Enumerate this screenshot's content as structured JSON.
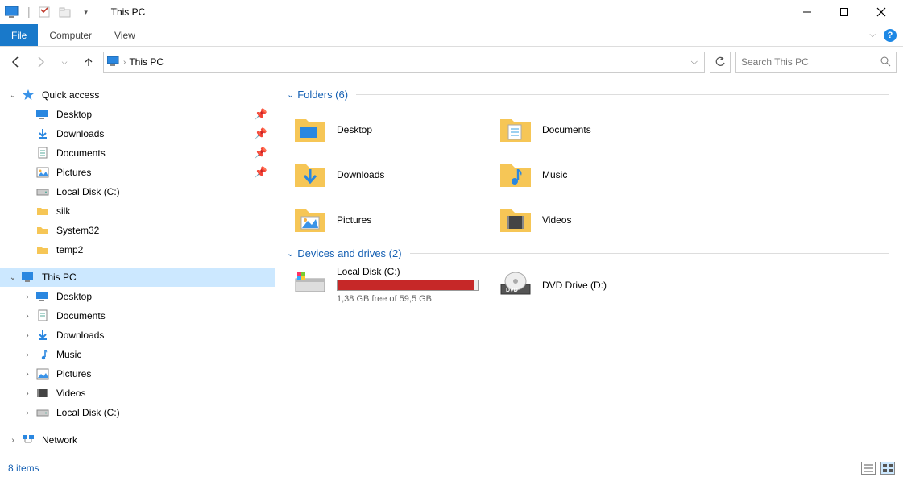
{
  "titlebar": {
    "title": "This PC"
  },
  "ribbon": {
    "file": "File",
    "tabs": [
      "Computer",
      "View"
    ]
  },
  "address": {
    "path": "This PC"
  },
  "search": {
    "placeholder": "Search This PC"
  },
  "sidebar": {
    "quick_access": {
      "label": "Quick access",
      "items": [
        {
          "label": "Desktop",
          "icon": "desktop",
          "pinned": true
        },
        {
          "label": "Downloads",
          "icon": "downloads",
          "pinned": true
        },
        {
          "label": "Documents",
          "icon": "documents",
          "pinned": true
        },
        {
          "label": "Pictures",
          "icon": "pictures",
          "pinned": true
        },
        {
          "label": "Local Disk (C:)",
          "icon": "disk",
          "pinned": false
        },
        {
          "label": "silk",
          "icon": "folder",
          "pinned": false
        },
        {
          "label": "System32",
          "icon": "folder",
          "pinned": false
        },
        {
          "label": "temp2",
          "icon": "folder",
          "pinned": false
        }
      ]
    },
    "this_pc": {
      "label": "This PC",
      "items": [
        {
          "label": "Desktop",
          "icon": "desktop"
        },
        {
          "label": "Documents",
          "icon": "documents"
        },
        {
          "label": "Downloads",
          "icon": "downloads"
        },
        {
          "label": "Music",
          "icon": "music"
        },
        {
          "label": "Pictures",
          "icon": "pictures"
        },
        {
          "label": "Videos",
          "icon": "videos"
        },
        {
          "label": "Local Disk (C:)",
          "icon": "disk"
        }
      ]
    },
    "network": {
      "label": "Network"
    }
  },
  "content": {
    "folders_head": "Folders (6)",
    "folders": [
      {
        "label": "Desktop",
        "icon": "desktop-big"
      },
      {
        "label": "Documents",
        "icon": "documents-big"
      },
      {
        "label": "Downloads",
        "icon": "downloads-big"
      },
      {
        "label": "Music",
        "icon": "music-big"
      },
      {
        "label": "Pictures",
        "icon": "pictures-big"
      },
      {
        "label": "Videos",
        "icon": "videos-big"
      }
    ],
    "drives_head": "Devices and drives (2)",
    "drives": [
      {
        "label": "Local Disk (C:)",
        "sub": "1,38 GB free of 59,5 GB",
        "fill_pct": 97,
        "icon": "localdisk"
      },
      {
        "label": "DVD Drive (D:)",
        "icon": "dvd"
      }
    ]
  },
  "status": {
    "count": "8 items"
  }
}
